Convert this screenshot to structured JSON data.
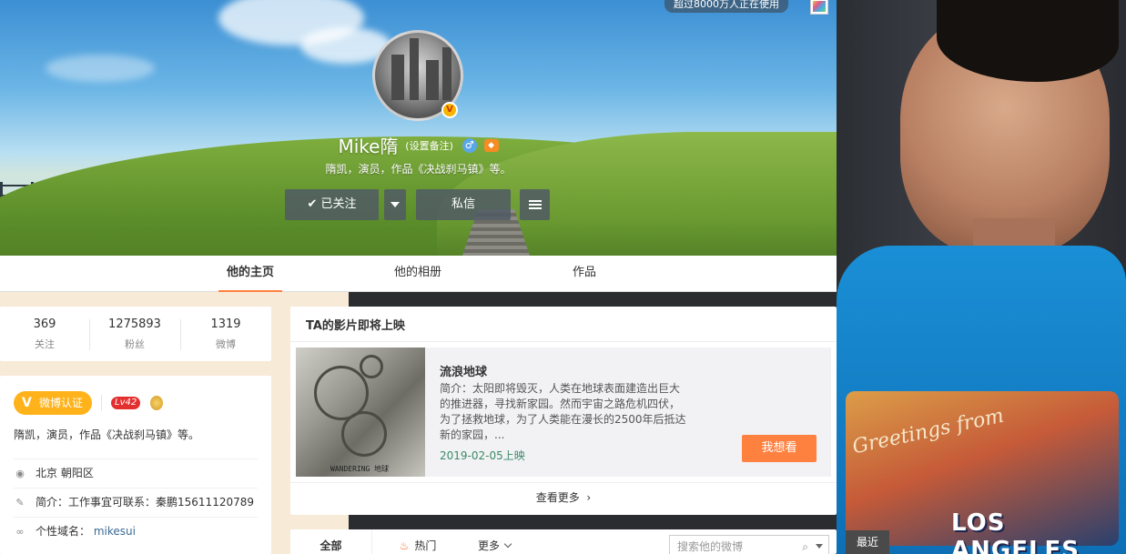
{
  "banner": {
    "user_count": "超过8000万人正在使用",
    "name": "Mike隋",
    "remark": "(设置备注)",
    "gender_symbol": "♂",
    "bio": "隋凯，演员，作品《决战刹马镇》等。",
    "follow_label": "已关注",
    "message_label": "私信",
    "verified_mark": "V"
  },
  "tabs": [
    "他的主页",
    "他的相册",
    "作品"
  ],
  "stats": [
    {
      "value": "369",
      "label": "关注"
    },
    {
      "value": "1275893",
      "label": "粉丝"
    },
    {
      "value": "1319",
      "label": "微博"
    }
  ],
  "profile": {
    "cert_label": "微博认证",
    "cert_v": "V",
    "level": "Lv42",
    "bio": "隋凯，演员，作品《决战刹马镇》等。",
    "location": "北京 朝阳区",
    "intro_label": "简介：",
    "intro_value": "工作事宜可联系：秦鹏15611120789",
    "domain_label": "个性域名：",
    "domain_value": "mikesui"
  },
  "film": {
    "header": "TA的影片即将上映",
    "title": "流浪地球",
    "description": "简介：太阳即将毁灭，人类在地球表面建造出巨大的推进器，寻找新家园。然而宇宙之路危机四伏，为了拯救地球，为了人类能在漫长的2500年后抵达新的家园，...",
    "release": "2019-02-05上映",
    "want_label": "我想看",
    "poster_caption": "WANDERING 地球",
    "see_more": "查看更多"
  },
  "feed": {
    "tab_all": "全部",
    "tab_hot": "热门",
    "tab_more": "更多",
    "search_placeholder": "搜索他的微博"
  },
  "recent_label": "最近",
  "photo": {
    "shirt_text1": "Greetings from",
    "shirt_text2": "LOS ANGELES"
  },
  "colors": {
    "accent": "#ff8140",
    "cert": "#ffb21a",
    "level": "#e42f2f"
  }
}
